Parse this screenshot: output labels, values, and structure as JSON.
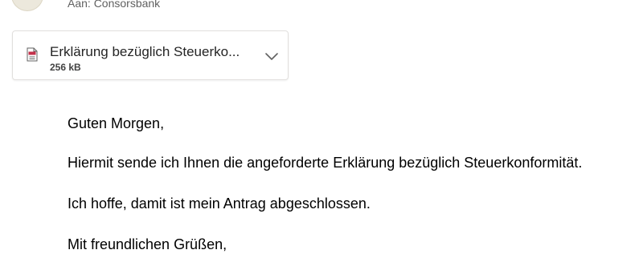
{
  "message": {
    "recipient_line": "Aan: Consorsbank"
  },
  "attachment": {
    "file_name": "Erklärung bezüglich Steuerko...",
    "file_size": "256 kB",
    "icon": "pdf-file-icon",
    "expand_icon": "chevron-down-icon"
  },
  "body": {
    "greeting": "Guten Morgen,",
    "paragraph1": "Hiermit sende ich Ihnen die angeforderte Erklärung bezüglich Steuerkonformität.",
    "paragraph2": "Ich hoffe, damit ist mein Antrag abgeschlossen.",
    "closing": "Mit freundlichen Grüßen,"
  },
  "colors": {
    "text": "#000000",
    "secondary_text": "#616161",
    "pdf_red": "#c4314b",
    "border": "#e1dfdd"
  }
}
